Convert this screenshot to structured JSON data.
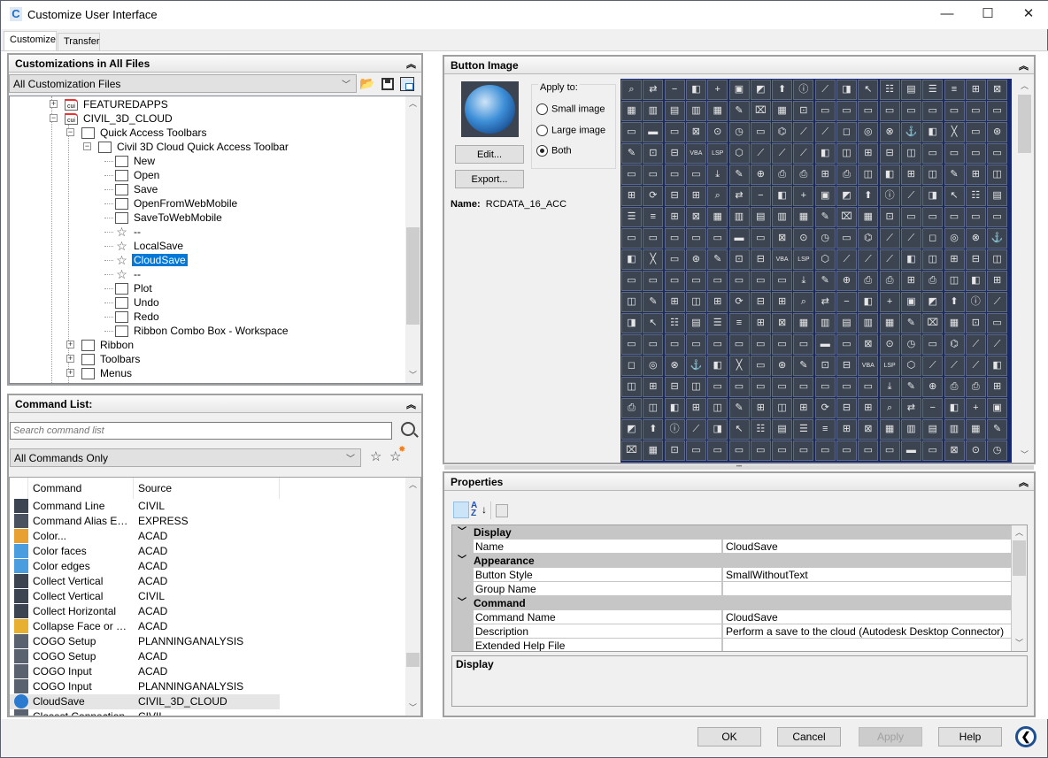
{
  "window": {
    "title": "Customize User Interface",
    "app_icon": "C",
    "minimize": "—",
    "maximize": "☐",
    "close": "✕"
  },
  "tabs": [
    {
      "label": "Customize",
      "active": true
    },
    {
      "label": "Transfer",
      "active": false
    }
  ],
  "customizations": {
    "header": "Customizations in All Files",
    "collapse_icon": "⌃",
    "filter": "All Customization Files",
    "tree": [
      {
        "label": "FEATUREDAPPS",
        "level": 0,
        "icon": "cui",
        "expander": "+"
      },
      {
        "label": "CIVIL_3D_CLOUD",
        "level": 0,
        "icon": "cui",
        "expander": "−"
      },
      {
        "label": "Quick Access Toolbars",
        "level": 1,
        "icon": "toolbar",
        "expander": "−"
      },
      {
        "label": "Civil 3D Cloud Quick Access Toolbar",
        "level": 2,
        "icon": "toolbar",
        "expander": "−"
      },
      {
        "label": "New",
        "level": 3,
        "icon": "command"
      },
      {
        "label": "Open",
        "level": 3,
        "icon": "command"
      },
      {
        "label": "Save",
        "level": 3,
        "icon": "command"
      },
      {
        "label": "OpenFromWebMobile",
        "level": 3,
        "icon": "command"
      },
      {
        "label": "SaveToWebMobile",
        "level": 3,
        "icon": "command"
      },
      {
        "label": "--",
        "level": 3,
        "icon": "star"
      },
      {
        "label": "LocalSave",
        "level": 3,
        "icon": "star"
      },
      {
        "label": "CloudSave",
        "level": 3,
        "icon": "star",
        "selected": true
      },
      {
        "label": "--",
        "level": 3,
        "icon": "star"
      },
      {
        "label": "Plot",
        "level": 3,
        "icon": "command"
      },
      {
        "label": "Undo",
        "level": 3,
        "icon": "command"
      },
      {
        "label": "Redo",
        "level": 3,
        "icon": "command"
      },
      {
        "label": "Ribbon Combo Box - Workspace",
        "level": 3,
        "icon": "command"
      },
      {
        "label": "Ribbon",
        "level": 1,
        "icon": "ribbon",
        "expander": "+"
      },
      {
        "label": "Toolbars",
        "level": 1,
        "icon": "toolbars",
        "expander": "+"
      },
      {
        "label": "Menus",
        "level": 1,
        "icon": "menus",
        "expander": "+"
      }
    ]
  },
  "command_list": {
    "header": "Command List:",
    "search_placeholder": "Search command list",
    "filter": "All Commands Only",
    "columns": [
      "Command",
      "Source"
    ],
    "rows": [
      {
        "command": "Command Line",
        "source": "CIVIL",
        "color": "#3b4450"
      },
      {
        "command": "Command Alias Edit...",
        "source": "EXPRESS",
        "color": "#4a5260"
      },
      {
        "command": "Color...",
        "source": "ACAD",
        "color": "#e8a030"
      },
      {
        "command": "Color faces",
        "source": "ACAD",
        "color": "#4a9ee0"
      },
      {
        "command": "Color edges",
        "source": "ACAD",
        "color": "#4a9ee0"
      },
      {
        "command": "Collect Vertical",
        "source": "ACAD",
        "color": "#3b4450"
      },
      {
        "command": "Collect Vertical",
        "source": "CIVIL",
        "color": "#3b4450"
      },
      {
        "command": "Collect Horizontal",
        "source": "ACAD",
        "color": "#3b4450"
      },
      {
        "command": "Collapse Face or Ed...",
        "source": "ACAD",
        "color": "#e8b030"
      },
      {
        "command": "COGO Setup",
        "source": "PLANNINGANALYSIS",
        "color": "#5a6270"
      },
      {
        "command": "COGO Setup",
        "source": "ACAD",
        "color": "#5a6270"
      },
      {
        "command": "COGO Input",
        "source": "ACAD",
        "color": "#5a6270"
      },
      {
        "command": "COGO Input",
        "source": "PLANNINGANALYSIS",
        "color": "#5a6270"
      },
      {
        "command": "CloudSave",
        "source": "CIVIL_3D_CLOUD",
        "color": "#2a7ad0",
        "selected": true
      },
      {
        "command": "Closest Connection",
        "source": "CIVIL",
        "color": "#5a6270"
      }
    ]
  },
  "button_image": {
    "header": "Button Image",
    "apply_to_label": "Apply to:",
    "options": [
      "Small image",
      "Large image",
      "Both"
    ],
    "selected_option": "Both",
    "edit_label": "Edit...",
    "export_label": "Export...",
    "name_label": "Name:",
    "name_value": "RCDATA_16_ACC",
    "grid_glyphs": [
      "⌕",
      "⇄",
      "−",
      "◧",
      "+",
      "▣",
      "◩",
      "⬆",
      "ⓘ",
      "⟋",
      "◨",
      "↖",
      "☷",
      "▤",
      "☰",
      "≡",
      "⊞",
      "⊠",
      "▦",
      "▥",
      "▤",
      "▥",
      "▦",
      "✎",
      "⌧",
      "▦",
      "⊡",
      "▭",
      "▭",
      "▭",
      "▭",
      "▭",
      "▭",
      "▭",
      "▭",
      "▭",
      "▭",
      "▬",
      "▭",
      "⊠",
      "⊙",
      "◷",
      "▭",
      "⌬",
      "⟋",
      "⟋",
      "◻",
      "◎",
      "⊗",
      "⚓",
      "◧",
      "╳",
      "▭",
      "⊛",
      "✎",
      "⊡",
      "⊟",
      "VBA",
      "LSP",
      "⬡",
      "⟋",
      "⟋",
      "⟋",
      "◧",
      "◫",
      "⊞",
      "⊟",
      "◫",
      "▭",
      "▭",
      "▭",
      "▭",
      "▭",
      "▭",
      "▭",
      "▭",
      "⤓",
      "✎",
      "⊕",
      "⎙",
      "⎙",
      "⊞",
      "⎙",
      "◫",
      "◧",
      "⊞",
      "◫",
      "✎",
      "⊞",
      "◫",
      "⊞",
      "⟳",
      "⊟",
      "⊞"
    ]
  },
  "properties": {
    "header": "Properties",
    "rows": [
      {
        "type": "category",
        "label": "Display"
      },
      {
        "type": "prop",
        "key": "Name",
        "value": "CloudSave"
      },
      {
        "type": "category",
        "label": "Appearance"
      },
      {
        "type": "prop",
        "key": "Button Style",
        "value": "SmallWithoutText"
      },
      {
        "type": "prop",
        "key": "Group Name",
        "value": ""
      },
      {
        "type": "category",
        "label": "Command"
      },
      {
        "type": "prop",
        "key": "Command Name",
        "value": "CloudSave"
      },
      {
        "type": "prop",
        "key": "Description",
        "value": "Perform a save to the cloud (Autodesk Desktop Connector)"
      },
      {
        "type": "prop",
        "key": "Extended Help File",
        "value": ""
      }
    ],
    "description_title": "Display"
  },
  "footer": {
    "ok": "OK",
    "cancel": "Cancel",
    "apply": "Apply",
    "help": "Help",
    "collapse_icon": "❮"
  }
}
